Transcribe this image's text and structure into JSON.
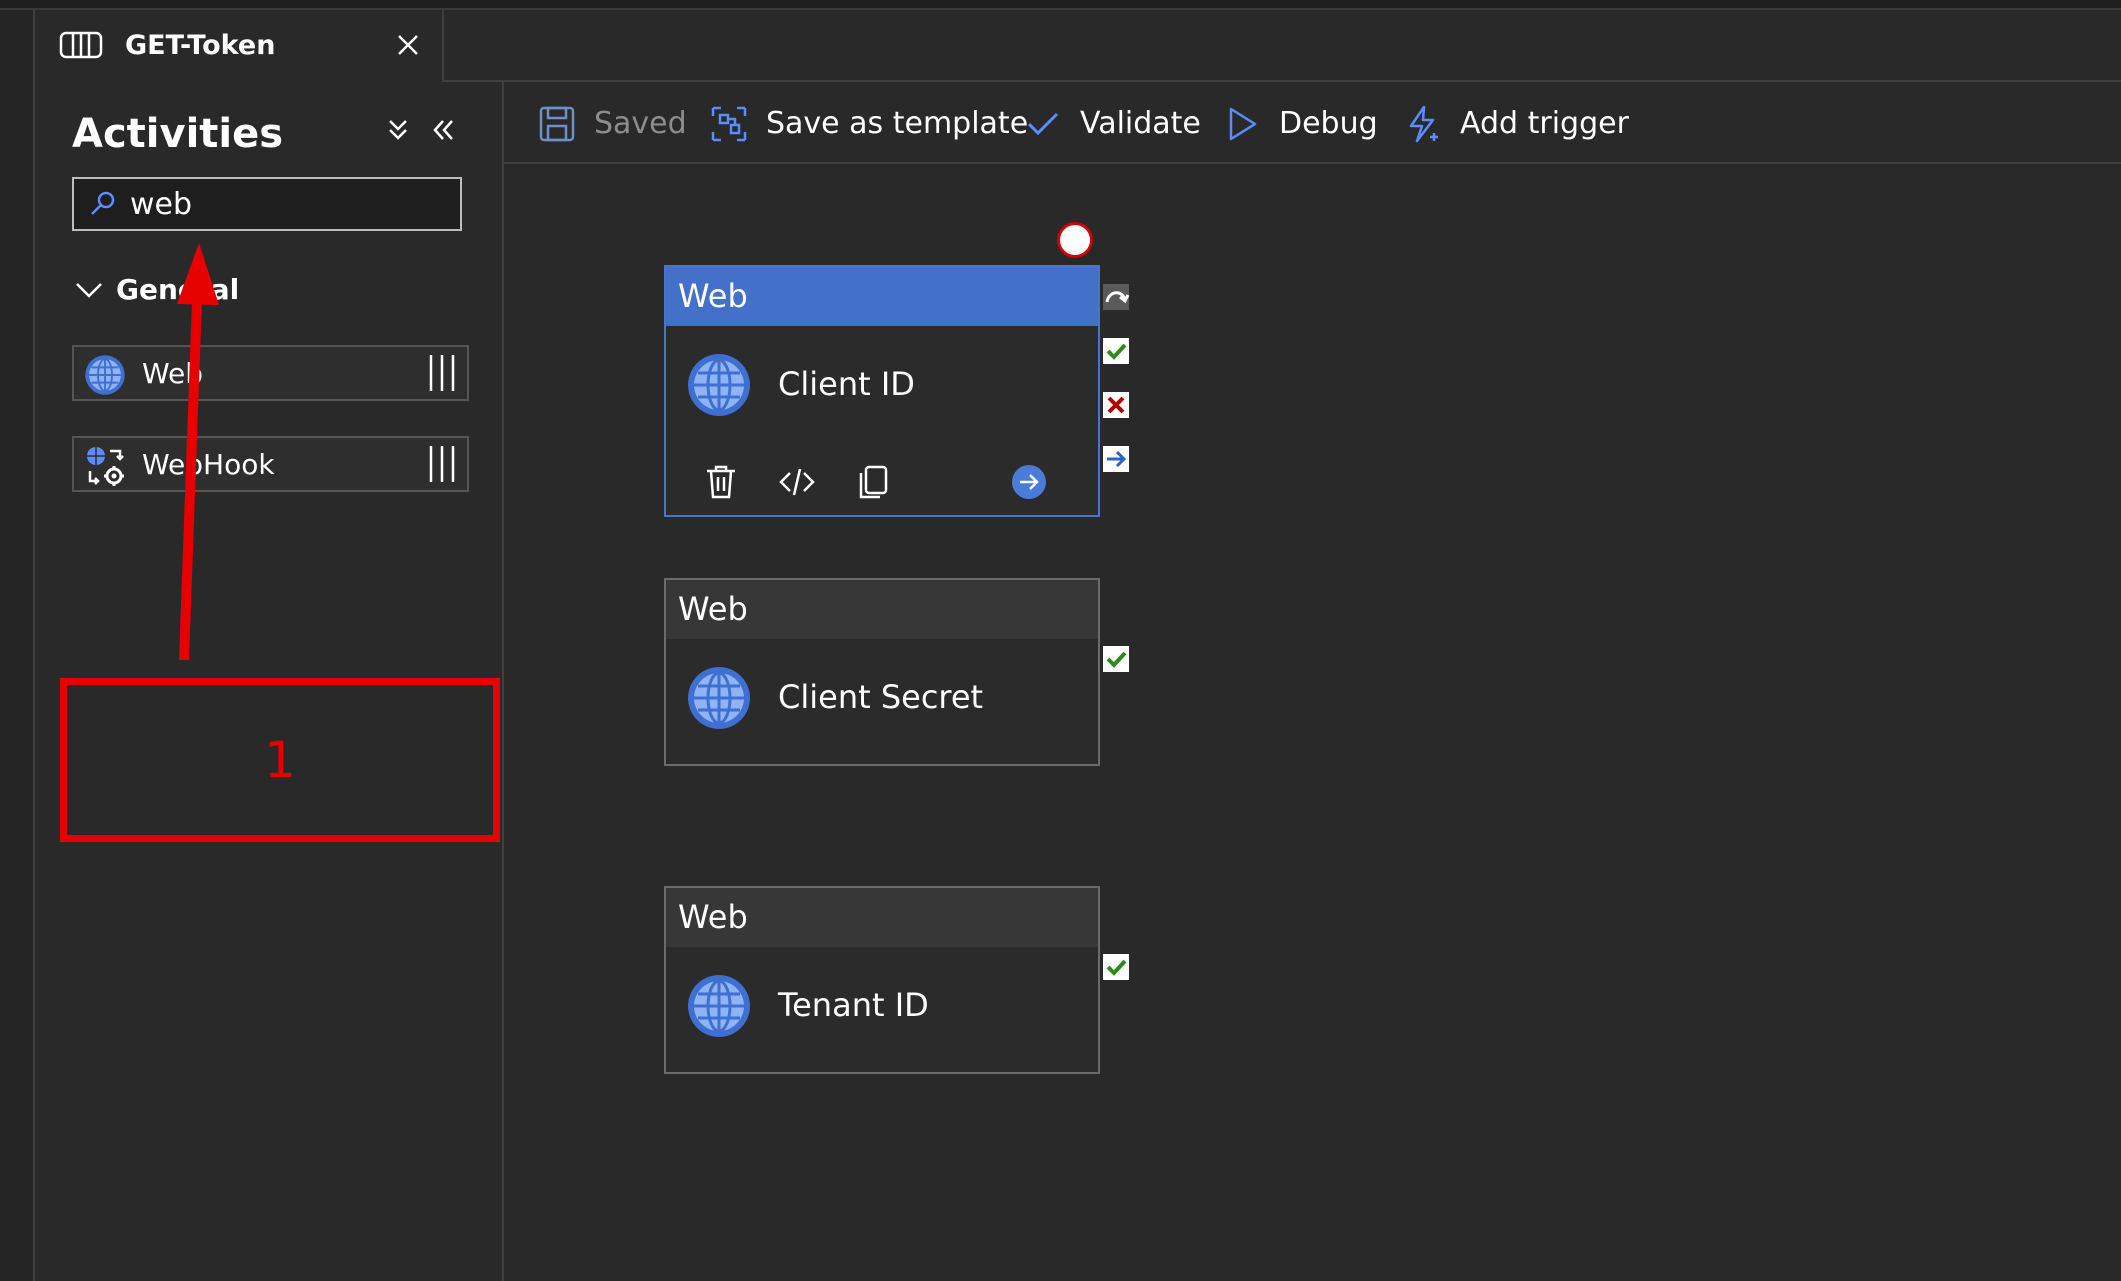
{
  "tab": {
    "title": "GET-Token"
  },
  "panel": {
    "title": "Activities",
    "search": {
      "value": "web",
      "placeholder": ""
    },
    "group": {
      "label": "General"
    },
    "items": [
      {
        "label": "Web"
      },
      {
        "label": "WebHook"
      }
    ]
  },
  "toolbar": {
    "saved": "Saved",
    "save_as_template": "Save as template",
    "validate": "Validate",
    "debug": "Debug",
    "add_trigger": "Add trigger"
  },
  "annotation": {
    "number": "1"
  },
  "nodes": [
    {
      "type": "Web",
      "name": "Client ID"
    },
    {
      "type": "Web",
      "name": "Client Secret"
    },
    {
      "type": "Web",
      "name": "Tenant ID"
    }
  ],
  "colors": {
    "accent": "#4370c8",
    "annotation": "#e60000",
    "success": "#3a8c1f",
    "failure": "#b00000"
  }
}
